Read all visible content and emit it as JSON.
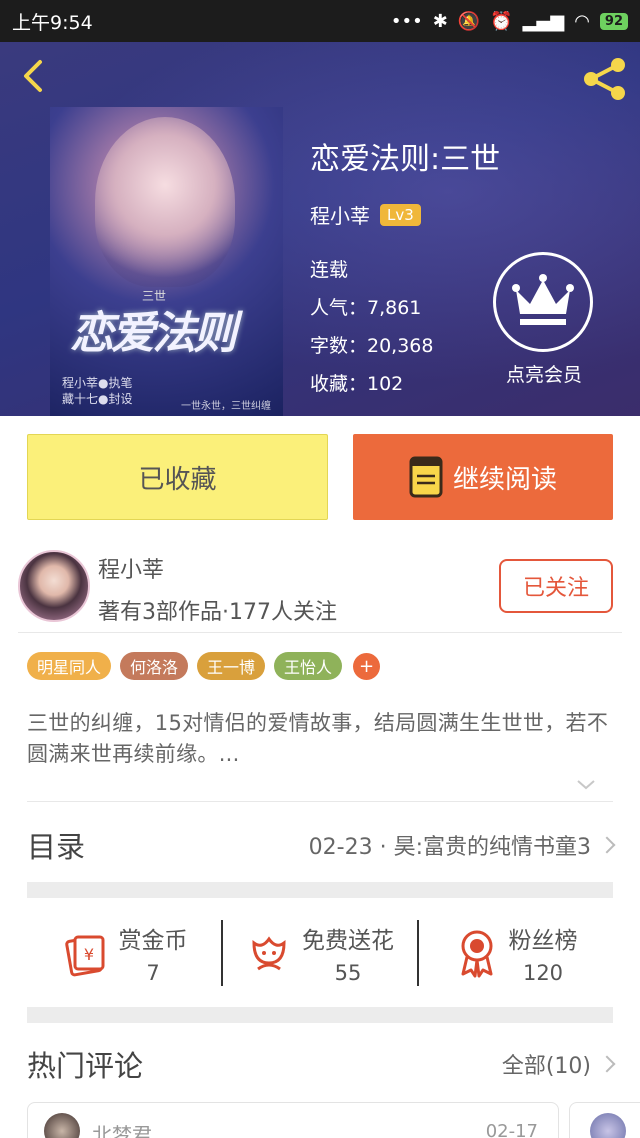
{
  "status_bar": {
    "time": "上午9:54",
    "icons": [
      "more-dots-icon",
      "bluetooth-icon",
      "mute-icon",
      "alarm-icon",
      "signal-icon",
      "wifi-icon"
    ],
    "battery": "92"
  },
  "book": {
    "title": "恋爱法则:三世",
    "author": "程小莘",
    "level": "Lv3",
    "status": "连载",
    "popularity": "人气：7,861",
    "word_count": "字数：20,368",
    "favorites": "收藏：102",
    "cover_title": "恋爱法则",
    "cover_subtitle": "三世",
    "cover_credit_1": "程小莘●执笔",
    "cover_credit_2": "藏十七●封设",
    "cover_tagline": "一世永世，三世纠缠"
  },
  "vip": {
    "label": "点亮会员"
  },
  "actions": {
    "collected": "已收藏",
    "read": "继续阅读"
  },
  "author_card": {
    "name": "程小莘",
    "stats": "著有3部作品·177人关注",
    "follow": "已关注"
  },
  "tags": [
    {
      "label": "明星同人",
      "color": "#f0b04a"
    },
    {
      "label": "何洛洛",
      "color": "#c47a5c"
    },
    {
      "label": "王一博",
      "color": "#d9a03c"
    },
    {
      "label": "王怡人",
      "color": "#8fb25a"
    }
  ],
  "tag_add": "+",
  "synopsis": "三世的纠缠，15对情侣的爱情故事，结局圆满生生世世，若不圆满来世再续前缘。...",
  "catalog": {
    "title": "目录",
    "latest": "02-23 · 昊:富贵的纯情书童3"
  },
  "rewards": [
    {
      "label": "赏金币",
      "count": "7",
      "icon": "gold-envelope-icon"
    },
    {
      "label": "免费送花",
      "count": "55",
      "icon": "flower-icon"
    },
    {
      "label": "粉丝榜",
      "count": "120",
      "icon": "medal-icon"
    }
  ],
  "comments": {
    "title": "热门评论",
    "all": "全部(10)",
    "first": {
      "user": "北梦君",
      "date": "02-17"
    }
  },
  "colors": {
    "accent": "#ec6a3c",
    "collected_bg": "#fbf07a",
    "header_bg": "#2f3681",
    "icon_red": "#d94a2f",
    "level_badge": "#f0b73a"
  }
}
